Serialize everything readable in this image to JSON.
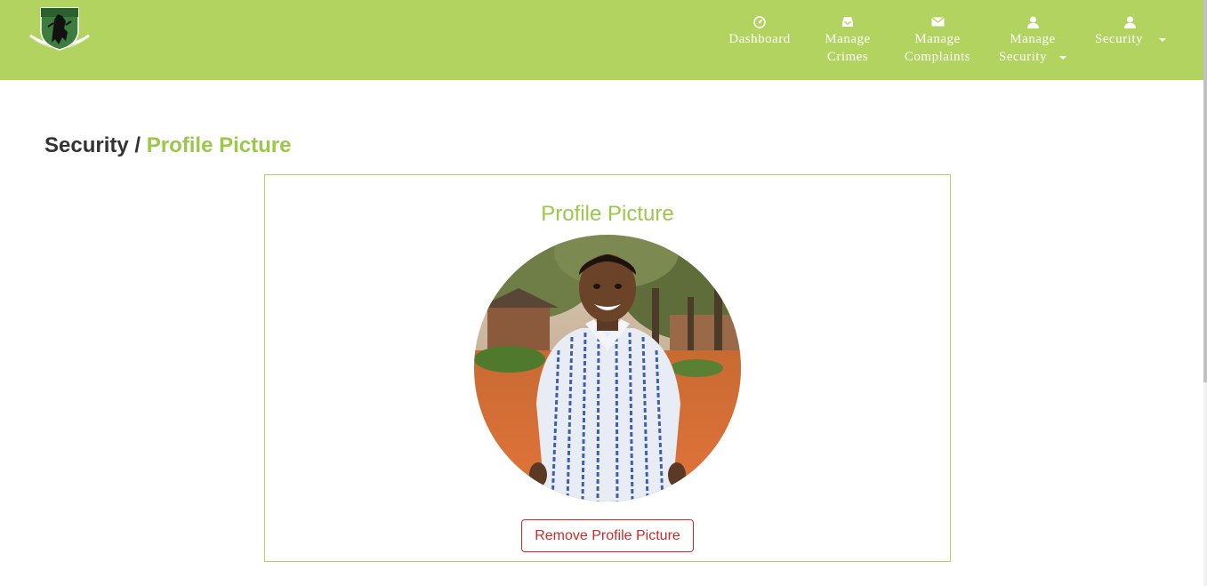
{
  "colors": {
    "navbar": "#b2d360",
    "accent": "#9bc74a",
    "danger": "#cc2b2b",
    "text": "#333333"
  },
  "nav": {
    "items": [
      {
        "icon": "dashboard-icon",
        "line1": "Dashboard",
        "line2": ""
      },
      {
        "icon": "inbox-icon",
        "line1": "Manage",
        "line2": "Crimes"
      },
      {
        "icon": "envelope-icon",
        "line1": "Manage",
        "line2": "Complaints"
      },
      {
        "icon": "user-icon",
        "line1": "Manage",
        "line2": "Security"
      },
      {
        "icon": "user-icon",
        "line1": "Security",
        "line2": ""
      }
    ]
  },
  "breadcrumb": {
    "parent": "Security",
    "separator": " / ",
    "current": "Profile Picture"
  },
  "card": {
    "title": "Profile Picture",
    "remove_button": "Remove Profile Picture"
  }
}
